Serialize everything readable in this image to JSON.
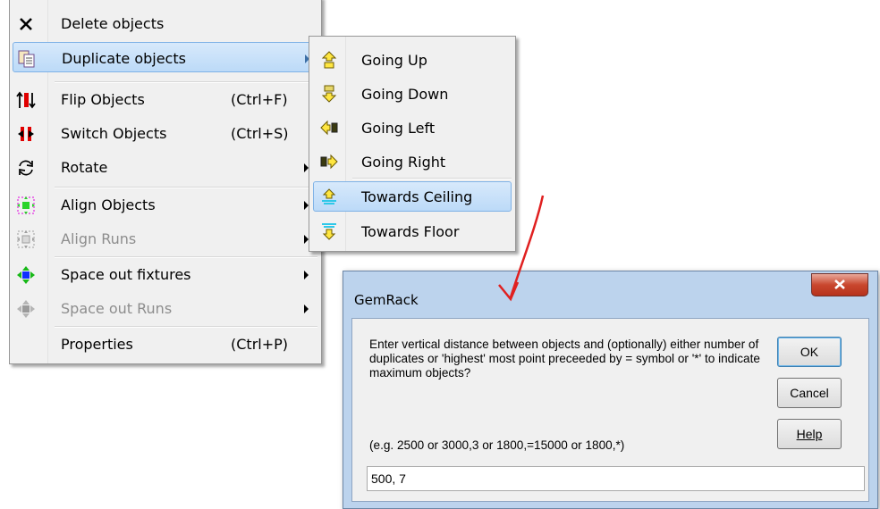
{
  "context_menu": {
    "items": [
      {
        "label": "Delete objects",
        "shortcut": "",
        "icon": "delete-x-icon"
      },
      {
        "label": "Duplicate objects",
        "shortcut": "",
        "icon": "duplicate-icon",
        "highlighted": true
      },
      {
        "label": "Flip Objects",
        "shortcut": "(Ctrl+F)",
        "icon": "flip-icon"
      },
      {
        "label": "Switch Objects",
        "shortcut": "(Ctrl+S)",
        "icon": "switch-icon"
      },
      {
        "label": "Rotate",
        "shortcut": "",
        "icon": "rotate-icon"
      },
      {
        "label": "Align Objects",
        "shortcut": "",
        "icon": "align-objects-icon"
      },
      {
        "label": "Align Runs",
        "shortcut": "",
        "icon": "align-runs-icon",
        "disabled": true
      },
      {
        "label": "Space out fixtures",
        "shortcut": "",
        "icon": "space-out-fixtures-icon"
      },
      {
        "label": "Space out Runs",
        "shortcut": "",
        "icon": "space-out-runs-icon",
        "disabled": true
      },
      {
        "label": "Properties",
        "shortcut": "(Ctrl+P)",
        "icon": ""
      }
    ]
  },
  "submenu": {
    "items": [
      {
        "label": "Going Up",
        "icon": "arrow-up-icon"
      },
      {
        "label": "Going Down",
        "icon": "arrow-down-icon"
      },
      {
        "label": "Going Left",
        "icon": "arrow-left-icon"
      },
      {
        "label": "Going Right",
        "icon": "arrow-right-icon"
      },
      {
        "label": "Towards Ceiling",
        "icon": "towards-ceiling-icon",
        "highlighted": true
      },
      {
        "label": "Towards Floor",
        "icon": "towards-floor-icon"
      }
    ]
  },
  "dialog": {
    "title": "GemRack",
    "prompt": "Enter vertical distance between objects and (optionally) either number of duplicates or 'highest' most point preceeded by = symbol or '*' to indicate maximum objects?",
    "example": "(e.g. 2500 or 3000,3 or 1800,=15000 or 1800,*)",
    "input_value": "500, 7",
    "ok_label": "OK",
    "cancel_label": "Cancel",
    "help_label": "Help"
  },
  "colors": {
    "highlight": "#cce4f7",
    "annotation_arrow": "#e02020"
  }
}
